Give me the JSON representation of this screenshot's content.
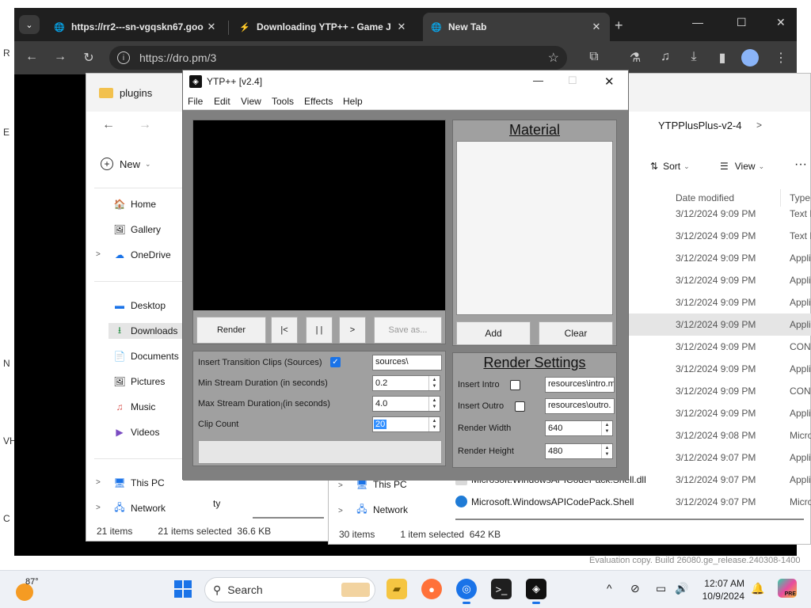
{
  "chrome": {
    "tabs": [
      {
        "title": "https://rr2---sn-vgqskn67.goo"
      },
      {
        "title": "Downloading YTP++ - Game J"
      },
      {
        "title": "New Tab"
      }
    ],
    "url": "https://dro.pm/3"
  },
  "explorer_left": {
    "title": "plugins",
    "new_label": "New",
    "nav": [
      "Home",
      "Gallery",
      "OneDrive",
      "Desktop",
      "Downloads",
      "Documents",
      "Pictures",
      "Music",
      "Videos",
      "This PC",
      "Network"
    ],
    "partial_text": "ty",
    "status_count": "21 items",
    "status_selected": "21 items selected  36.6 KB"
  },
  "explorer_right": {
    "breadcrumb": "YTPPlusPlus-v2-4",
    "sort_label": "Sort",
    "view_label": "View",
    "columns": {
      "date": "Date modified",
      "type": "Type"
    },
    "rows": [
      {
        "date": "3/12/2024 9:09 PM",
        "type": "Text D"
      },
      {
        "date": "3/12/2024 9:09 PM",
        "type": "Text D"
      },
      {
        "date": "3/12/2024 9:09 PM",
        "type": "Appli"
      },
      {
        "date": "3/12/2024 9:09 PM",
        "type": "Appli"
      },
      {
        "date": "3/12/2024 9:09 PM",
        "type": "Appli"
      },
      {
        "date": "3/12/2024 9:09 PM",
        "type": "Appli"
      },
      {
        "date": "3/12/2024 9:09 PM",
        "type": "CONI"
      },
      {
        "date": "3/12/2024 9:09 PM",
        "type": "Appli"
      },
      {
        "date": "3/12/2024 9:09 PM",
        "type": "CONI"
      },
      {
        "date": "3/12/2024 9:09 PM",
        "type": "Appli"
      },
      {
        "date": "3/12/2024 9:08 PM",
        "type": "Micro"
      },
      {
        "date": "3/12/2024 9:07 PM",
        "type": "Appli",
        "name": "ll"
      },
      {
        "date": "3/12/2024 9:07 PM",
        "type": "Appli",
        "name": "Microsoft.WindowsAPICodePack.Shell.dll"
      },
      {
        "date": "3/12/2024 9:07 PM",
        "type": "Micro",
        "name": "Microsoft.WindowsAPICodePack.Shell"
      }
    ],
    "nav": [
      "This PC",
      "Network"
    ],
    "status_count": "30 items",
    "status_selected": "1 item selected  642 KB"
  },
  "ytp": {
    "title": "YTP++ [v2.4]",
    "menu": [
      "File",
      "Edit",
      "View",
      "Tools",
      "Effects",
      "Help"
    ],
    "buttons": {
      "render": "Render",
      "first": "|<",
      "pause": "| |",
      "play": ">",
      "save_as": "Save as..."
    },
    "material": {
      "heading": "Material",
      "add": "Add",
      "clear": "Clear"
    },
    "settings": {
      "insert_transitions_label": "Insert Transition Clips (Sources)",
      "sources_path": "sources\\",
      "min_stream_label": "Min Stream Duration (in seconds)",
      "min_stream_value": "0.2",
      "max_stream_label": "Max Stream Duration (in seconds)",
      "max_stream_value": "4.0",
      "clip_count_label": "Clip Count",
      "clip_count_value": "20"
    },
    "render": {
      "heading": "Render Settings",
      "insert_intro_label": "Insert Intro",
      "intro_path": "resources\\intro.m",
      "insert_outro_label": "Insert Outro",
      "outro_path": "resources\\outro.",
      "width_label": "Render Width",
      "width_value": "640",
      "height_label": "Render Height",
      "height_value": "480"
    }
  },
  "taskbar": {
    "temperature": "87°",
    "search_label": "Search",
    "time": "12:07 AM",
    "date": "10/9/2024",
    "badge": "PRE",
    "watermark": "Evaluation copy. Build 26080.ge_release.240308-1400"
  },
  "colors": {
    "accent": "#1a73e8",
    "ytp_bg": "#808080",
    "ytp_panel": "#a0a0a0",
    "chrome_dark": "#3c3c3c"
  }
}
